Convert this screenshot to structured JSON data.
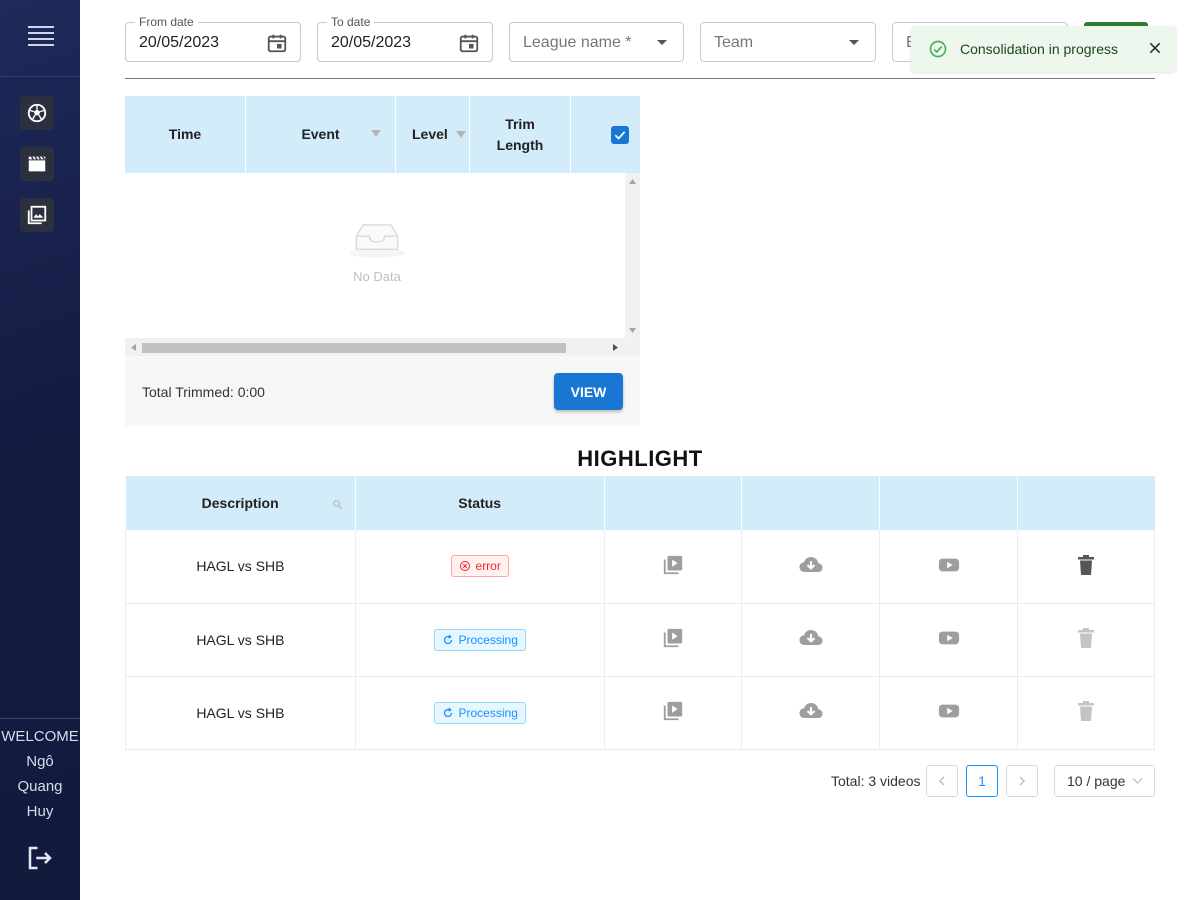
{
  "sidebar": {
    "nav": [
      {
        "icon": "soccer-ball-icon"
      },
      {
        "icon": "clapperboard-icon"
      },
      {
        "icon": "photo-library-icon"
      }
    ],
    "welcome_label": "WELCOME",
    "user_first": "Ngô",
    "user_middle": "Quang",
    "user_last": "Huy"
  },
  "filters": {
    "from_date": {
      "label": "From date",
      "value": "20/05/2023"
    },
    "to_date": {
      "label": "To date",
      "value": "20/05/2023"
    },
    "league": {
      "placeholder": "League name *"
    },
    "team": {
      "placeholder": "Team"
    },
    "partial_field_text": "E"
  },
  "toast": {
    "message": "Consolidation in progress",
    "color": "#edf7ed"
  },
  "event_table": {
    "headers": [
      "Time",
      "Event",
      "Level",
      "Trim Length"
    ],
    "select_all_checked": true,
    "empty_text": "No Data",
    "total_trimmed": "Total Trimmed: 0:00",
    "view_label": "VIEW"
  },
  "highlight": {
    "title": "HIGHLIGHT",
    "headers": [
      "Description",
      "Status"
    ],
    "rows": [
      {
        "description": "HAGL vs SHB",
        "status": "error"
      },
      {
        "description": "HAGL vs SHB",
        "status": "Processing"
      },
      {
        "description": "HAGL vs SHB",
        "status": "Processing"
      }
    ]
  },
  "pagination": {
    "total": "Total: 3 videos",
    "current_page": "1",
    "page_size": "10 / page"
  },
  "colors": {
    "accent": "#1976d2",
    "header_bg": "#d3ecf9",
    "error": "#f5222d",
    "processing": "#1890ff"
  }
}
